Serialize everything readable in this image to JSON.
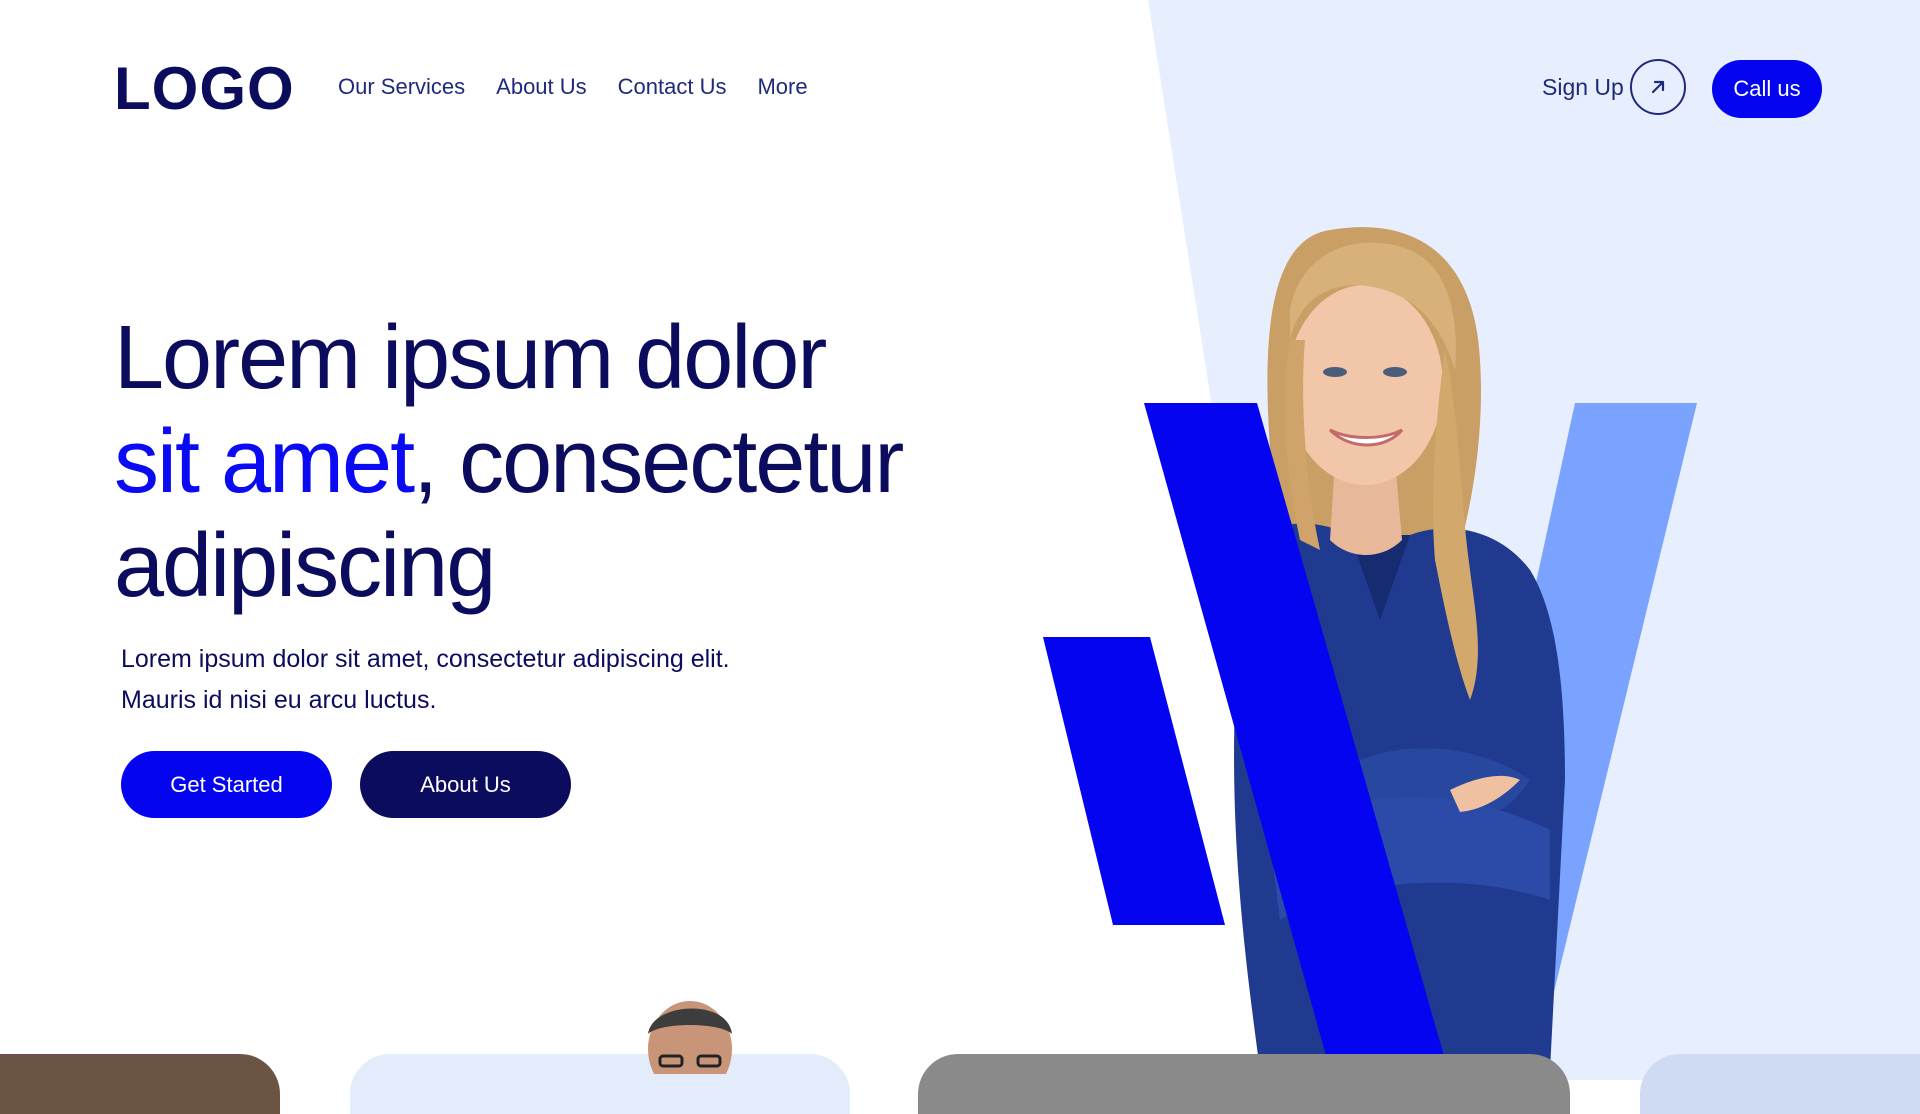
{
  "brand": {
    "logo_text": "LOGO",
    "primary_color": "#0404f0",
    "navy_color": "#0c0c5e",
    "panel_color": "#e7efff"
  },
  "nav": {
    "items": [
      {
        "label": "Our Services"
      },
      {
        "label": "About Us"
      },
      {
        "label": "Contact Us"
      },
      {
        "label": "More"
      }
    ]
  },
  "header_actions": {
    "signup_label": "Sign Up",
    "signup_icon": "arrow-up-right-icon",
    "call_label": "Call us"
  },
  "hero": {
    "headline_line1": "Lorem ipsum dolor",
    "headline_accent": "sit amet",
    "headline_line2_rest": ", consectetur",
    "headline_line3": "adipiscing",
    "subtext_line1": "Lorem ipsum dolor sit amet, consectetur adipiscing elit.",
    "subtext_line2": "Mauris id nisi eu arcu luctus.",
    "primary_button": "Get Started",
    "secondary_button": "About Us"
  }
}
